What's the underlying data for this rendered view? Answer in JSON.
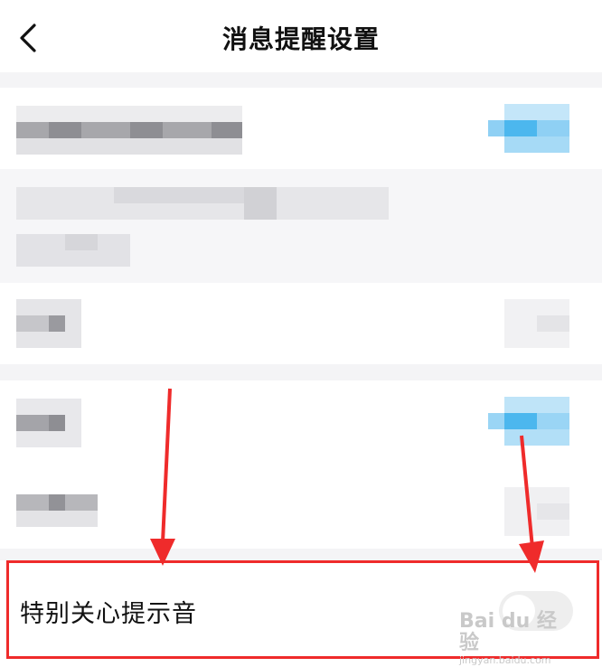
{
  "header": {
    "title": "消息提醒设置",
    "back_icon": "chevron-left-icon"
  },
  "special_care": {
    "label": "特别关心提示音",
    "toggle_on": false
  },
  "watermark": {
    "main": "Bai du 经验",
    "sub": "jingyan.baidu.com"
  },
  "colors": {
    "annotation_red": "#ef2b2b",
    "toggle_on_blue": "#4cb7ee",
    "section_gap": "#f4f4f6"
  }
}
